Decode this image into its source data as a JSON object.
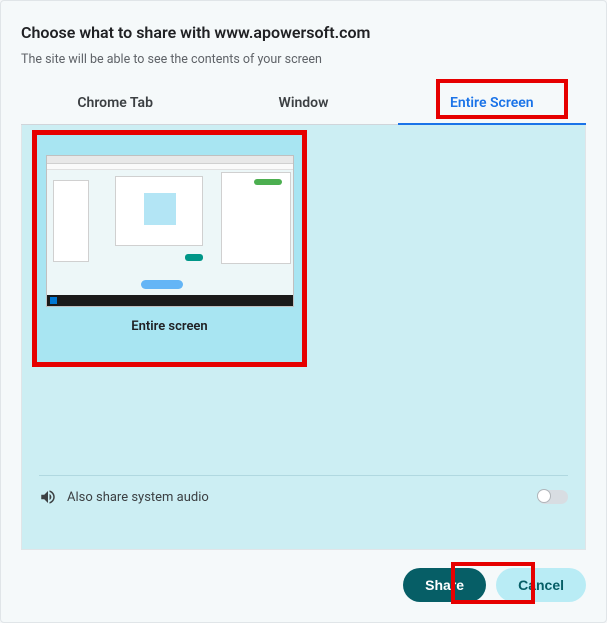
{
  "dialog": {
    "title": "Choose what to share with www.apowersoft.com",
    "subtitle": "The site will be able to see the contents of your screen"
  },
  "tabs": {
    "chrome_tab": "Chrome Tab",
    "window": "Window",
    "entire_screen": "Entire Screen"
  },
  "screen_option": {
    "label": "Entire screen"
  },
  "audio": {
    "label": "Also share system audio"
  },
  "buttons": {
    "share": "Share",
    "cancel": "Cancel"
  }
}
